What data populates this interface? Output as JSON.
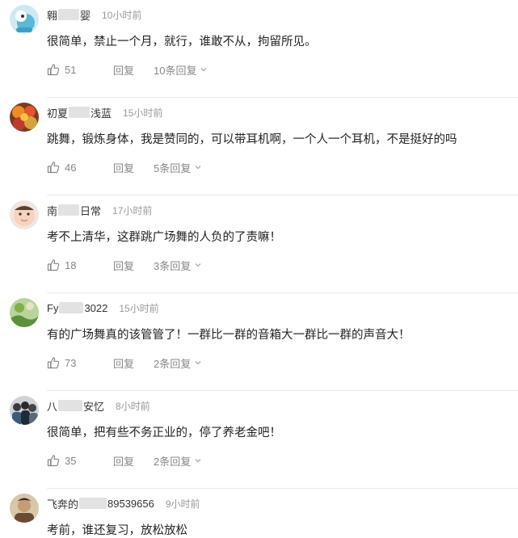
{
  "comments": [
    {
      "user_start": "翱",
      "user_end": "婴",
      "time": "10小时前",
      "text": "很简单，禁止一个月，就行，谁敢不从，拘留所见。",
      "likes": "51",
      "reply": "回复",
      "reply_count": "10条回复",
      "avatar": "cartoon"
    },
    {
      "user_start": "初夏",
      "user_end": "浅蓝",
      "time": "15小时前",
      "text": "跳舞，锻炼身体，我是赞同的，可以带耳机啊，一个人一个耳机，不是挺好的吗",
      "likes": "46",
      "reply": "回复",
      "reply_count": "5条回复",
      "avatar": "fruits"
    },
    {
      "user_start": "南",
      "user_end": "日常",
      "time": "17小时前",
      "text": "考不上清华，这群跳广场舞的人负的了责嘛！",
      "likes": "18",
      "reply": "回复",
      "reply_count": "3条回复",
      "avatar": "baby"
    },
    {
      "user_start": "Fy",
      "user_end": "3022",
      "time": "15小时前",
      "text": "有的广场舞真的该管管了！一群比一群的音箱大一群比一群的声音大！",
      "likes": "73",
      "reply": "回复",
      "reply_count": "2条回复",
      "avatar": "plant"
    },
    {
      "user_start": "八",
      "user_end": "安忆",
      "time": "8小时前",
      "text": "很简单，把有些不务正业的，停了养老金吧！",
      "likes": "35",
      "reply": "回复",
      "reply_count": "2条回复",
      "avatar": "group"
    },
    {
      "user_start": "飞奔的",
      "user_end": "89539656",
      "time": "9小时前",
      "text": "考前，谁还复习，放松放松",
      "likes": "",
      "reply": "",
      "reply_count": "",
      "avatar": "portrait"
    }
  ]
}
